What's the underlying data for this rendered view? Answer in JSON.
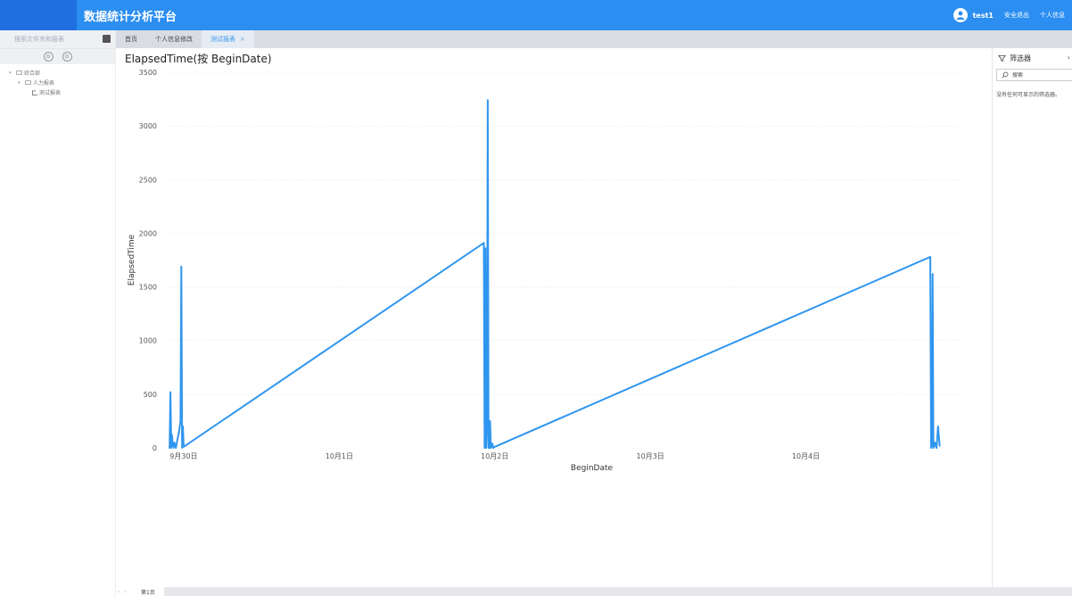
{
  "header": {
    "app_title": "数据统计分析平台",
    "user_name": "test1",
    "links": [
      "安全退出",
      "个人信息"
    ]
  },
  "sidebar": {
    "search_placeholder": "搜索文件夹和报表",
    "circle_buttons": [
      "⊙",
      "⊙"
    ],
    "tree": [
      {
        "label": "综合部",
        "level": 0,
        "kind": "folder",
        "toggle": "▾"
      },
      {
        "label": "人力报表",
        "level": 1,
        "kind": "folder",
        "toggle": "▾"
      },
      {
        "label": "测试报表",
        "level": 2,
        "kind": "report",
        "toggle": ""
      }
    ]
  },
  "tabs": [
    {
      "label": "首页",
      "active": false
    },
    {
      "label": "个人信息修改",
      "active": false
    },
    {
      "label": "测试报表",
      "active": true,
      "closable": "×"
    }
  ],
  "filter_panel": {
    "title": "筛选器",
    "close": "›",
    "search_placeholder": "搜索",
    "empty_text": "没有任何可显示的筛选器。"
  },
  "bottom": {
    "nav": [
      "‹",
      "›"
    ],
    "page_tab": "第1页"
  },
  "chart_data": {
    "type": "line",
    "title": "ElapsedTime(按 BeginDate)",
    "xlabel": "BeginDate",
    "ylabel": "ElapsedTime",
    "ylim": [
      0,
      3500
    ],
    "yticks": [
      0,
      500,
      1000,
      1500,
      2000,
      2500,
      3000,
      3500
    ],
    "x_unit": "day",
    "xlim": [
      -0.12,
      5.0
    ],
    "xticks": [
      {
        "label": "9月30日",
        "value": 0
      },
      {
        "label": "10月1日",
        "value": 1
      },
      {
        "label": "10月2日",
        "value": 2
      },
      {
        "label": "10月3日",
        "value": 3
      },
      {
        "label": "10月4日",
        "value": 4
      }
    ],
    "grid": true,
    "color": "#2f96ef",
    "series": [
      {
        "name": "",
        "x": [
          -0.09,
          -0.085,
          -0.08,
          -0.075,
          -0.07,
          -0.065,
          -0.06,
          -0.05,
          -0.04,
          -0.03,
          -0.02,
          -0.015,
          -0.01,
          -0.005,
          0.0,
          1.93,
          1.935,
          1.94,
          1.945,
          1.95,
          1.955,
          1.96,
          1.965,
          1.97,
          1.975,
          1.98,
          1.985,
          1.99,
          2.0,
          4.8,
          4.805,
          4.81,
          4.815,
          4.82,
          4.825,
          4.83,
          4.84,
          4.85,
          4.86
        ],
        "y": [
          0,
          520,
          0,
          120,
          30,
          0,
          50,
          0,
          80,
          150,
          250,
          1690,
          0,
          200,
          10,
          1910,
          0,
          1860,
          0,
          200,
          3240,
          0,
          0,
          250,
          0,
          20,
          40,
          0,
          10,
          1780,
          0,
          30,
          1620,
          0,
          20,
          50,
          0,
          200,
          20
        ]
      }
    ]
  }
}
